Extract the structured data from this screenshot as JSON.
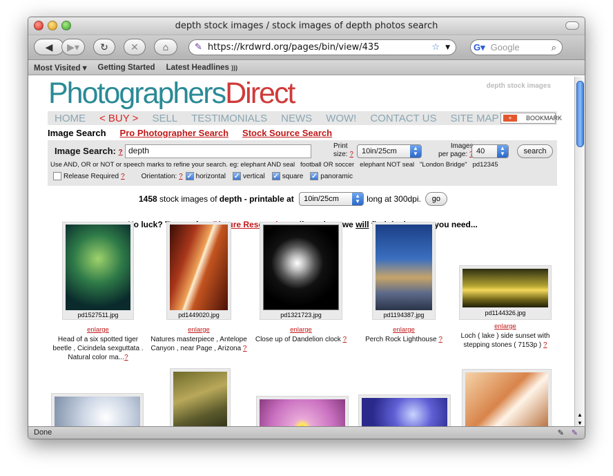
{
  "window": {
    "title": "depth stock images / stock images of depth photos search"
  },
  "browser": {
    "url": "https://krdwrd.org/pages/bin/view/435",
    "search_placeholder": "Google",
    "bookmarks": [
      "Most Visited ▾",
      "Getting Started",
      "Latest Headlines"
    ],
    "status": "Done"
  },
  "site": {
    "logo_part1": "Photographers",
    "logo_part2": "Direct",
    "top_note": "depth stock images",
    "nav": [
      "HOME",
      "< BUY >",
      "SELL",
      "TESTIMONIALS",
      "NEWS",
      "WOW!",
      "CONTACT US",
      "SITE MAP"
    ],
    "bookmark_label": "BOOKMARK",
    "tabs": {
      "current": "Image Search",
      "pro": "Pro Photographer Search",
      "source": "Stock Source Search"
    }
  },
  "search": {
    "label": "Image Search:",
    "qm": "?",
    "query": "depth",
    "print_size_label1": "Print",
    "print_size_label2": "size:",
    "print_size": "10in/25cm",
    "per_page_label1": "Images",
    "per_page_label2": "per page:",
    "per_page": "40",
    "search_button": "search",
    "hint": "Use AND, OR or NOT or speech marks to refine your search. eg: elephant AND seal   football OR soccer   elephant NOT seal   \"London Bridge\"   pd12345",
    "release_required": "Release Required",
    "orientation_label": "Orientation:",
    "orientations": [
      "horizontal",
      "vertical",
      "square",
      "panoramic"
    ]
  },
  "results": {
    "count": "1458",
    "text1": " stock images of ",
    "term": "depth",
    "text2": " - printable at ",
    "size": "10in/25cm",
    "text3": " long at 300dpi.",
    "go": "go",
    "noluck1": "No luck? Try our free ",
    "noluck_link": "Picture Research",
    "noluck2": " email service - we ",
    "noluck_will": "will",
    "noluck3": " find the images you need..."
  },
  "images": [
    {
      "file": "pd1527511.jpg",
      "enlarge": "enlarge",
      "caption": "Head of a six spotted tiger beetle , Cicindela sexguttata . Natural color ma...",
      "qm": "?"
    },
    {
      "file": "pd1449020.jpg",
      "enlarge": "enlarge",
      "caption": "Natures masterpiece , Antelope Canyon , near Page , Arizona",
      "qm": "?"
    },
    {
      "file": "pd1321723.jpg",
      "enlarge": "enlarge",
      "caption": "Close up of Dandelion clock",
      "qm": "?"
    },
    {
      "file": "pd1194387.jpg",
      "enlarge": "enlarge",
      "caption": "Perch Rock Lighthouse",
      "qm": "?"
    },
    {
      "file": "pd1144326.jpg",
      "enlarge": "enlarge",
      "caption": "Loch ( lake ) side sunset with stepping stones ( 7153p )",
      "qm": "?"
    }
  ]
}
